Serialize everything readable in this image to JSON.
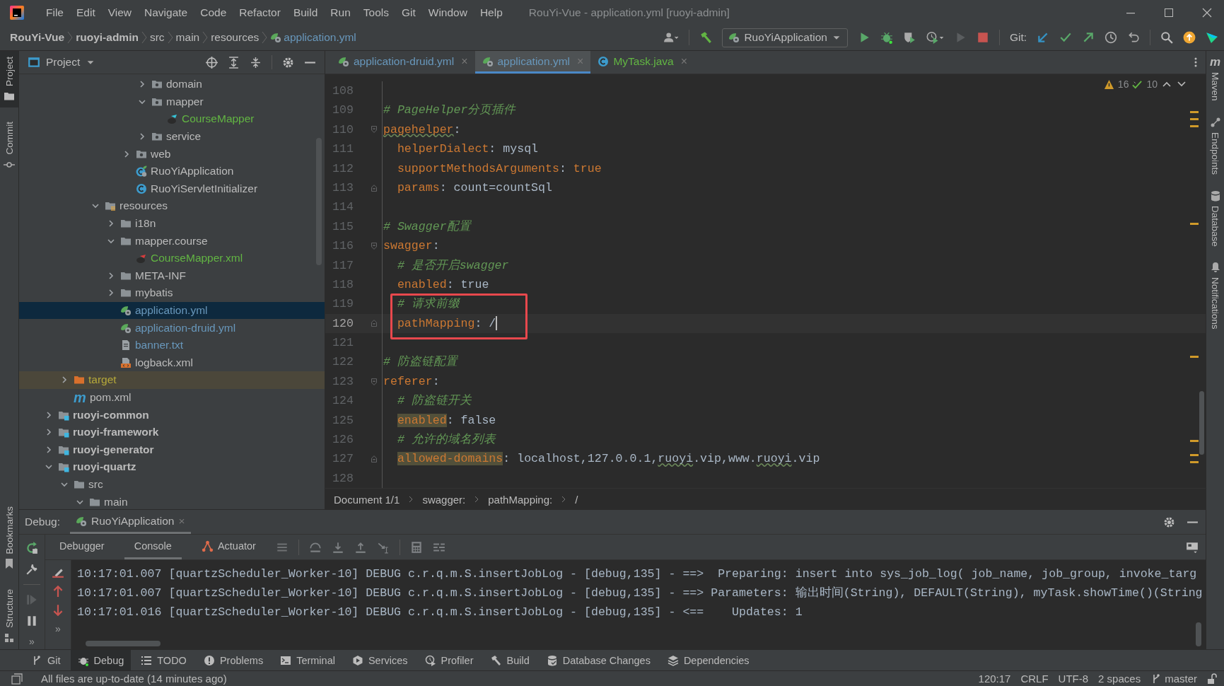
{
  "window": {
    "title": "RouYi-Vue - application.yml [ruoyi-admin]"
  },
  "menu": [
    "File",
    "Edit",
    "View",
    "Navigate",
    "Code",
    "Refactor",
    "Build",
    "Run",
    "Tools",
    "Git",
    "Window",
    "Help"
  ],
  "navigation": {
    "breadcrumbs": [
      {
        "label": "RouYi-Vue",
        "kind": "project"
      },
      {
        "label": "ruoyi-admin",
        "kind": "module"
      },
      {
        "label": "src",
        "kind": "folder"
      },
      {
        "label": "main",
        "kind": "folder"
      },
      {
        "label": "resources",
        "kind": "folder"
      },
      {
        "label": "application.yml",
        "kind": "yml"
      }
    ],
    "run_configuration": "RuoYiApplication",
    "git_label": "Git:"
  },
  "left_strip": {
    "top": [
      {
        "label": "Project",
        "kind": "project",
        "selected": true
      },
      {
        "label": "Commit",
        "kind": "commit",
        "selected": false
      }
    ],
    "bottom": [
      {
        "label": "Bookmarks",
        "kind": "bookmarks",
        "selected": false
      },
      {
        "label": "Structure",
        "kind": "structure",
        "selected": false
      }
    ]
  },
  "right_strip": [
    {
      "label": "Maven",
      "kind": "maven",
      "icon_text": "m"
    },
    {
      "label": "Endpoints",
      "kind": "endpoints"
    },
    {
      "label": "Database",
      "kind": "database"
    },
    {
      "label": "Notifications",
      "kind": "notifications"
    }
  ],
  "project": {
    "title": "Project",
    "tree": [
      {
        "children": [
          {
            "children": [
              {
                "children": [
                  {
                    "children": [
                      {
                        "children": [
                          {
                            "children": [
                              {
                                "label": "domain",
                                "kind": "package",
                                "expanded": false,
                                "selected": false
                              },
                              {
                                "label": "mapper",
                                "kind": "package",
                                "expanded": true,
                                "selected": false,
                                "children": [
                                  {
                                    "label": "CourseMapper",
                                    "kind": "bird",
                                    "color": "#62b543",
                                    "selected": false
                                  }
                                ]
                              },
                              {
                                "label": "service",
                                "kind": "package",
                                "expanded": false,
                                "selected": false
                              }
                            ]
                          },
                          {
                            "label": "web",
                            "kind": "package",
                            "expanded": false,
                            "selected": false
                          },
                          {
                            "label": "RuoYiApplication",
                            "kind": "spring-class",
                            "selected": false
                          },
                          {
                            "label": "RuoYiServletInitializer",
                            "kind": "class",
                            "selected": false
                          }
                        ]
                      }
                    ]
                  },
                  {
                    "label": "resources",
                    "kind": "resources",
                    "expanded": true,
                    "selected": false,
                    "children": [
                      {
                        "label": "i18n",
                        "kind": "folder",
                        "expanded": false,
                        "selected": false
                      },
                      {
                        "label": "mapper.course",
                        "kind": "folder",
                        "expanded": true,
                        "selected": false,
                        "children": [
                          {
                            "label": "CourseMapper.xml",
                            "kind": "bird-xml",
                            "color": "#62b543",
                            "selected": false
                          }
                        ]
                      },
                      {
                        "label": "META-INF",
                        "kind": "folder",
                        "expanded": false,
                        "selected": false
                      },
                      {
                        "label": "mybatis",
                        "kind": "folder",
                        "expanded": false,
                        "selected": false
                      },
                      {
                        "label": "application.yml",
                        "kind": "yml",
                        "color": "#6897bb",
                        "selected": true
                      },
                      {
                        "label": "application-druid.yml",
                        "kind": "yml",
                        "color": "#6897bb",
                        "selected": false
                      },
                      {
                        "label": "banner.txt",
                        "kind": "text",
                        "color": "#6897bb",
                        "selected": false
                      },
                      {
                        "label": "logback.xml",
                        "kind": "xml",
                        "selected": false
                      }
                    ]
                  }
                ]
              }
            ]
          },
          {
            "label": "target",
            "kind": "excluded",
            "expanded": false,
            "excluded": true,
            "color": "#b5a83a",
            "selected": false
          },
          {
            "label": "pom.xml",
            "kind": "maven",
            "icon_text": "m",
            "selected": false
          }
        ]
      },
      {
        "label": "ruoyi-common",
        "kind": "module",
        "expanded": false,
        "selected": false
      },
      {
        "label": "ruoyi-framework",
        "kind": "module",
        "expanded": false,
        "selected": false
      },
      {
        "label": "ruoyi-generator",
        "kind": "module",
        "expanded": false,
        "selected": false
      },
      {
        "label": "ruoyi-quartz",
        "kind": "module",
        "expanded": true,
        "selected": false,
        "children": [
          {
            "label": "src",
            "kind": "folder",
            "expanded": true,
            "selected": false,
            "children": [
              {
                "label": "main",
                "kind": "folder",
                "expanded": true,
                "selected": false
              }
            ]
          }
        ]
      }
    ]
  },
  "editor": {
    "tabs": [
      {
        "label": "application-druid.yml",
        "kind": "yml",
        "color": "#6897bb",
        "selected": false,
        "close": "×"
      },
      {
        "label": "application.yml",
        "kind": "yml",
        "color": "#6897bb",
        "selected": true,
        "close": "×"
      },
      {
        "label": "MyTask.java",
        "kind": "class",
        "color": "#62b543",
        "selected": false,
        "close": "×"
      }
    ],
    "inspections": {
      "warnings": "16",
      "weak_warnings": "10"
    },
    "lines": [
      {
        "number": "108"
      },
      {
        "number": "109",
        "tokens": [
          {
            "kind": "comment",
            "text": "# PageHelper分页插件"
          }
        ]
      },
      {
        "number": "110",
        "fold_start": true,
        "tokens": [
          {
            "kind": "key-typo",
            "text": "pagehelper"
          },
          {
            "kind": "plain",
            "text": ":"
          }
        ]
      },
      {
        "number": "111",
        "nested": true,
        "tokens": [
          {
            "kind": "key",
            "text": "helperDialect"
          },
          {
            "kind": "plain",
            "text": ": mysql"
          }
        ]
      },
      {
        "number": "112",
        "nested": true,
        "tokens": [
          {
            "kind": "key",
            "text": "supportMethodsArguments"
          },
          {
            "kind": "plain",
            "text": ": "
          },
          {
            "kind": "keyword",
            "text": "true"
          }
        ]
      },
      {
        "number": "113",
        "nested": true,
        "fold_end": true,
        "tokens": [
          {
            "kind": "key",
            "text": "params"
          },
          {
            "kind": "plain",
            "text": ": count=countSql"
          }
        ]
      },
      {
        "number": "114"
      },
      {
        "number": "115",
        "tokens": [
          {
            "kind": "comment",
            "text": "# Swagger配置"
          }
        ]
      },
      {
        "number": "116",
        "fold_start": true,
        "tokens": [
          {
            "kind": "key",
            "text": "swagger"
          },
          {
            "kind": "plain",
            "text": ":"
          }
        ]
      },
      {
        "number": "117",
        "nested": true,
        "tokens": [
          {
            "kind": "comment",
            "text": "# 是否开启swagger"
          }
        ]
      },
      {
        "number": "118",
        "nested": true,
        "tokens": [
          {
            "kind": "key",
            "text": "enabled"
          },
          {
            "kind": "plain",
            "text": ": true"
          }
        ]
      },
      {
        "number": "119",
        "nested": true,
        "boxed": true,
        "tokens": [
          {
            "kind": "comment",
            "text": "# 请求前缀"
          }
        ]
      },
      {
        "number": "120",
        "nested": true,
        "boxed": true,
        "current": true,
        "caret": true,
        "fold_end": true,
        "tokens": [
          {
            "kind": "key",
            "text": "pathMapping"
          },
          {
            "kind": "plain",
            "text": ": /"
          }
        ]
      },
      {
        "number": "121"
      },
      {
        "number": "122",
        "tokens": [
          {
            "kind": "comment",
            "text": "# 防盗链配置"
          }
        ]
      },
      {
        "number": "123",
        "fold_start": true,
        "tokens": [
          {
            "kind": "key",
            "text": "referer"
          },
          {
            "kind": "plain",
            "text": ":"
          }
        ]
      },
      {
        "number": "124",
        "nested": true,
        "tokens": [
          {
            "kind": "comment",
            "text": "# 防盗链开关"
          }
        ]
      },
      {
        "number": "125",
        "nested": true,
        "tokens": [
          {
            "kind": "key-marked",
            "text": "enabled"
          },
          {
            "kind": "plain",
            "text": ": false"
          }
        ]
      },
      {
        "number": "126",
        "nested": true,
        "tokens": [
          {
            "kind": "comment",
            "text": "# 允许的域名列表"
          }
        ]
      },
      {
        "number": "127",
        "nested": true,
        "fold_end": true,
        "tokens": [
          {
            "kind": "key-marked",
            "text": "allowed-domains"
          },
          {
            "kind": "plain",
            "text": ": localhost,127.0.0.1,"
          },
          {
            "kind": "typo",
            "text": "ruoyi"
          },
          {
            "kind": "plain",
            "text": ".vip,www."
          },
          {
            "kind": "typo",
            "text": "ruoyi"
          },
          {
            "kind": "plain",
            "text": ".vip"
          }
        ]
      },
      {
        "number": "128"
      }
    ],
    "breadcrumbs": [
      "Document 1/1",
      "swagger:",
      "pathMapping:",
      "/"
    ]
  },
  "debug": {
    "title": "Debug:",
    "session": {
      "label": "RuoYiApplication",
      "selected": true,
      "close": "×"
    },
    "tabs": [
      {
        "label": "Debugger",
        "kind": "debugger",
        "selected": false
      },
      {
        "label": "Console",
        "kind": "console",
        "selected": true
      },
      {
        "label": "Actuator",
        "kind": "actuator",
        "selected": false
      }
    ],
    "more": [
      "»",
      "»"
    ],
    "console": [
      "10:17:01.007 [quartzScheduler_Worker-10] DEBUG c.r.q.m.S.insertJobLog - [debug,135] - ==>  Preparing: insert into sys_job_log( job_name, job_group, invoke_targ",
      "10:17:01.007 [quartzScheduler_Worker-10] DEBUG c.r.q.m.S.insertJobLog - [debug,135] - ==> Parameters: 输出时间(String), DEFAULT(String), myTask.showTime()(String",
      "10:17:01.016 [quartzScheduler_Worker-10] DEBUG c.r.q.m.S.insertJobLog - [debug,135] - <==    Updates: 1"
    ]
  },
  "tool_tabs": [
    {
      "label": "Git",
      "kind": "git",
      "selected": false
    },
    {
      "label": "Debug",
      "kind": "debug",
      "selected": true
    },
    {
      "label": "TODO",
      "kind": "todo",
      "selected": false
    },
    {
      "label": "Problems",
      "kind": "problems",
      "selected": false
    },
    {
      "label": "Terminal",
      "kind": "terminal",
      "selected": false
    },
    {
      "label": "Services",
      "kind": "services",
      "selected": false
    },
    {
      "label": "Profiler",
      "kind": "profiler",
      "selected": false
    },
    {
      "label": "Build",
      "kind": "build",
      "selected": false
    },
    {
      "label": "Database Changes",
      "kind": "database",
      "selected": false
    },
    {
      "label": "Dependencies",
      "kind": "dependencies",
      "selected": false
    }
  ],
  "status_bar": {
    "message": "All files are up-to-date (14 minutes ago)",
    "position": "120:17",
    "line_separator": "CRLF",
    "encoding": "UTF-8",
    "indent": "2 spaces",
    "branch": "master"
  }
}
